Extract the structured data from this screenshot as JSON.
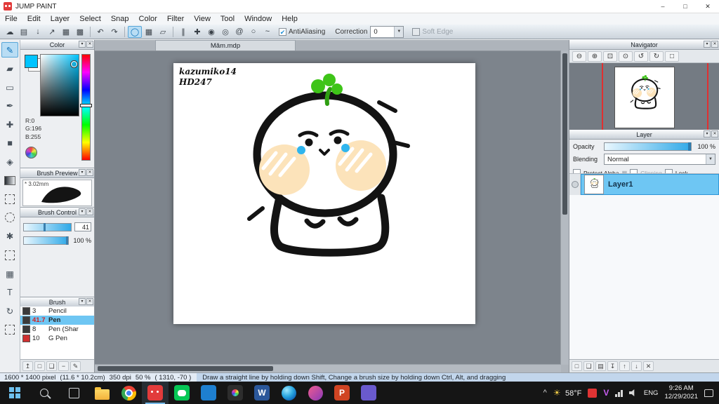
{
  "window": {
    "title": "JUMP PAINT",
    "minimize": "–",
    "maximize": "□",
    "close": "✕"
  },
  "menu": {
    "items": [
      "File",
      "Edit",
      "Layer",
      "Select",
      "Snap",
      "Color",
      "Filter",
      "View",
      "Tool",
      "Window",
      "Help"
    ]
  },
  "toolbar": {
    "antialiasing_label": "AntiAliasing",
    "correction_label": "Correction",
    "correction_value": "0",
    "soft_edge_label": "Soft Edge"
  },
  "panels": {
    "color": {
      "title": "Color",
      "r": "R:0",
      "g": "G:196",
      "b": "B:255",
      "current_color": "#00c4ff"
    },
    "brush_preview": {
      "title": "Brush Preview",
      "size_label": "* 3.02mm"
    },
    "brush_control": {
      "title": "Brush Control",
      "size_value": "41",
      "opacity_value": "100 %"
    },
    "brush": {
      "title": "Brush",
      "items": [
        {
          "size": "3",
          "name": "Pencil"
        },
        {
          "size": "41.7",
          "name": "Pen"
        },
        {
          "size": "8",
          "name": "Pen (Shar"
        },
        {
          "size": "10",
          "name": "G Pen"
        }
      ]
    },
    "navigator": {
      "title": "Navigator"
    },
    "layer": {
      "title": "Layer",
      "opacity_label": "Opacity",
      "opacity_value": "100 %",
      "blending_label": "Blending",
      "blending_value": "Normal",
      "protect_alpha_label": "Protect Alpha",
      "clipping_label": "Clipping",
      "lock_label": "Lock",
      "layers": [
        {
          "name": "Layer1"
        }
      ]
    }
  },
  "canvas": {
    "tab_name": "Măm.mdp",
    "signature_line1": "kazumiko14",
    "signature_line2": "HD247"
  },
  "status_bar": {
    "dimensions": "1600 * 1400 pixel",
    "size_cm": "(11.6 * 10.2cm)",
    "dpi": "350 dpi",
    "zoom": "50 %",
    "coordinates": "( 1310,  -70 )",
    "hint": "Draw a straight line by holding down Shift, Change a brush size by holding down Ctrl, Alt, and dragging"
  },
  "taskbar": {
    "weather_temp": "58°F",
    "language": "ENG",
    "time": "9:26 AM",
    "date": "12/29/2021"
  },
  "colors": {
    "accent_blue": "#2fa9e8",
    "selection_blue": "#6ec6f3",
    "picked_color": "#00c4ff",
    "canvas_bg": "#7d848c",
    "taskbar_bg": "#151515"
  },
  "icons": {
    "panel_collapse": "▾",
    "panel_close": "✕",
    "cloud": "☁",
    "gallery": "▤",
    "save": "↓",
    "export": "↗",
    "material": "▦",
    "resource": "▩",
    "undo": "↶",
    "redo": "↷",
    "snap_off": "◯",
    "snap_grid": "▦",
    "snap_perspective": "▱",
    "snap_parallel": "∥",
    "snap_cross": "✚",
    "snap_vanish": "◉",
    "snap_concentric": "◎",
    "snap_spiral": "@",
    "snap_ellipse": "○",
    "snap_free": "~",
    "dropdown_arrow": "▼",
    "check": "✔",
    "pen_tool": "✎",
    "eraser_tool": "▰",
    "rect_tool": "▭",
    "nib_tool": "✒",
    "move_tool": "✚",
    "fill_tool": "■",
    "bucket_tool": "◈",
    "wand_tool": "✱",
    "mesh_tool": "▦",
    "text_tool": "T",
    "rotate_tool": "↻",
    "zoom_out": "⊖",
    "zoom_in": "⊕",
    "zoom_fit": "⊡",
    "zoom_actual": "⊙",
    "rotate_left": "↺",
    "rotate_right": "↻",
    "reset_view": "□",
    "import_brush": "↥",
    "add_brush": "□",
    "dup_brush": "❏",
    "remove_brush": "−",
    "edit_brush": "✎",
    "add_layer": "□",
    "dup_layer": "❏",
    "folder_layer": "▤",
    "merge_layer": "↧",
    "up_layer": "↑",
    "down_layer": "↓",
    "delete_layer": "✕",
    "tray_chevron": "^",
    "sun": "☀"
  }
}
